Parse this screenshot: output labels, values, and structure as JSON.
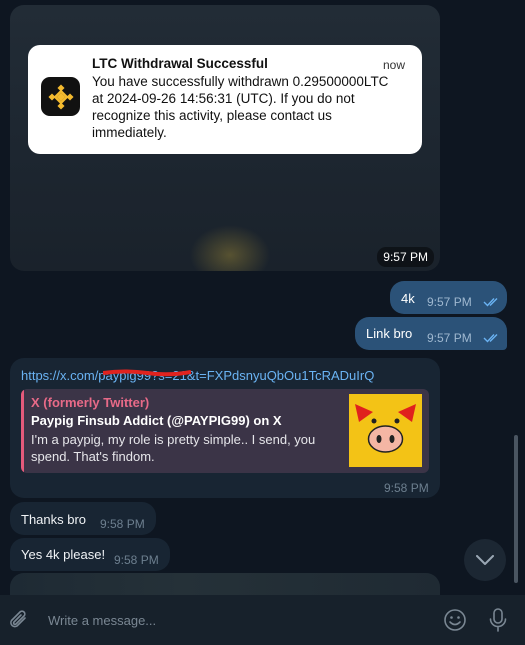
{
  "image_message": {
    "notification": {
      "app_icon": "binance-logo-icon",
      "title": "LTC Withdrawal Successful",
      "body": "You have successfully withdrawn 0.29500000LTC at 2024-09-26 14:56:31 (UTC). If you do not recognize this activity, please contact us immediately.",
      "time": "now"
    },
    "time": "9:57 PM"
  },
  "outgoing": [
    {
      "text": "4k",
      "time": "9:57 PM",
      "status": "read"
    },
    {
      "text": "Link bro",
      "time": "9:57 PM",
      "status": "read"
    }
  ],
  "link_message": {
    "url": "https://x.com/paypig99?s=21&t=FXPdsnyuQbOu1TcRADuIrQ",
    "preview": {
      "site": "X (formerly Twitter)",
      "title": "Paypig Finsub Addict (@PAYPIG99) on X",
      "description": "I'm a paypig, my role is pretty simple.. I send, you spend. That's findom."
    },
    "time": "9:58 PM"
  },
  "incoming": [
    {
      "text": "Thanks bro",
      "time": "9:58 PM"
    },
    {
      "text": "Yes 4k please!",
      "time": "9:58 PM"
    }
  ],
  "composer": {
    "placeholder": "Write a message...",
    "icons": [
      "paperclip-icon",
      "emoji-icon",
      "microphone-icon"
    ]
  },
  "colors": {
    "background": "#0e1621",
    "outgoing_bubble": "#2b5278",
    "incoming_bubble": "#182533",
    "link": "#6ab3f3",
    "accent_site": "#e86a88"
  }
}
